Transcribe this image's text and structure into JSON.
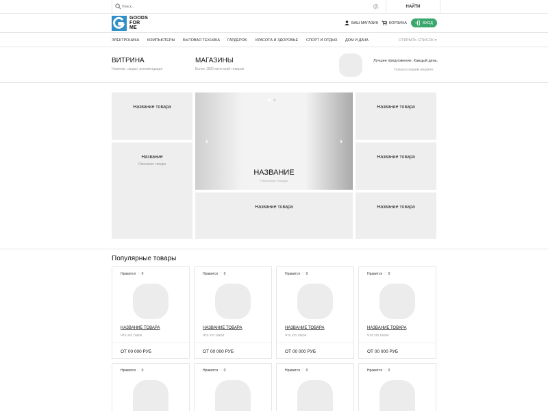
{
  "search": {
    "placeholder": "Поиск...",
    "button": "НАЙТИ"
  },
  "header": {
    "logo_lines": [
      "GOODS",
      "FOR",
      "ME"
    ],
    "my_store": "ВАШ МАГАЗИН",
    "cart": "КОРЗИНА",
    "login": "ВХОД"
  },
  "categories": {
    "items": [
      "ЭЛЕКТРОНИКА",
      "КОМПЬЮТЕРЫ",
      "БЫТОВАЯ ТЕХНИКА",
      "ГАРДЕРОБ",
      "КРАСОТА И ЗДОРОВЬЕ",
      "СПОРТ И ОТДЫХ",
      "ДОМ И ДАЧА"
    ],
    "open_list": "ОТКРЫТЬ СПИСОК"
  },
  "sections": {
    "showcase": {
      "title": "ВИТРИНА",
      "subtitle": "Новинки, скидки, рекомендации"
    },
    "stores": {
      "title": "МАГАЗИНЫ",
      "subtitle": "Более 1500 категорий товаров"
    },
    "promo_line1": "Лучшее предложение. Каждый день.",
    "promo_line2": "Только в нашем маркете"
  },
  "grid": {
    "tile_top_left": "Название товара",
    "tile_mid_left_title": "Название",
    "tile_mid_left_desc": "Описание товара",
    "tile_top_right": "Название товара",
    "tile_mid_right": "Название товара",
    "tile_bottom_right": "Название товара",
    "tile_bottom_center": "Название товара",
    "slide_title": "НАЗВАНИЕ",
    "slide_desc": "Описание товара"
  },
  "popular": {
    "title": "Популярные товары",
    "card": {
      "like_label": "Нравится",
      "like_count": "0",
      "name": "НАЗВАНИЕ ТОВАРА",
      "what": "Что это такое",
      "price": "ОТ 00 000 РУБ"
    }
  },
  "colors": {
    "brand_blue": "#2f8fc7",
    "login_green": "#3aa76d",
    "placeholder_gray": "#eeeeee"
  }
}
